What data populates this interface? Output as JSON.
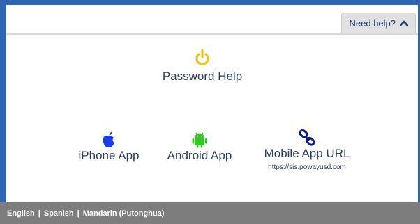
{
  "header": {
    "help_label": "Need help?",
    "help_icon": "chevron-up-icon"
  },
  "password_help": {
    "label": "Password Help",
    "icon": "power-icon",
    "icon_color": "#f2c20f"
  },
  "apps": {
    "iphone": {
      "label": "iPhone App",
      "icon": "apple-icon",
      "icon_color": "#1a3fe6"
    },
    "android": {
      "label": "Android App",
      "icon": "android-icon",
      "icon_color": "#2ecc1a"
    },
    "mobile_url": {
      "label": "Mobile App URL",
      "url": "https://sis.powayusd.com",
      "icon": "link-icon",
      "icon_color": "#0d1a8a"
    }
  },
  "footer": {
    "languages": [
      "English",
      "Spanish",
      "Mandarin (Putonghua)"
    ],
    "separator": "|"
  }
}
